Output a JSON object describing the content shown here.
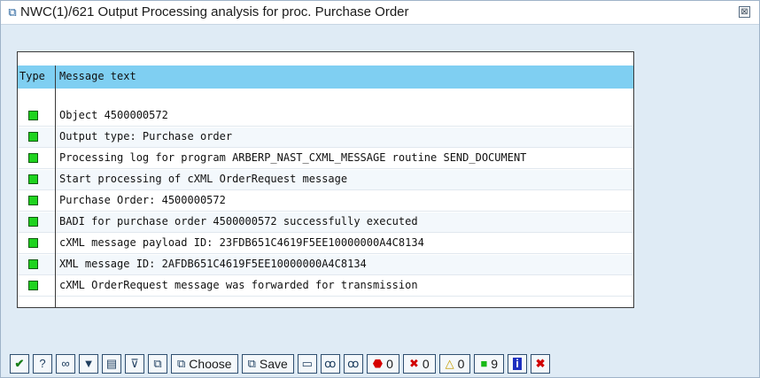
{
  "window": {
    "title": "NWC(1)/621 Output Processing analysis for proc. Purchase Order",
    "close_label": "⊠"
  },
  "table": {
    "columns": [
      "Type",
      "Message text"
    ],
    "rows": [
      {
        "type": "success",
        "text": "Object 4500000572"
      },
      {
        "type": "success",
        "text": "Output type: Purchase order"
      },
      {
        "type": "success",
        "text": "Processing log for program ARBERP_NAST_CXML_MESSAGE routine SEND_DOCUMENT"
      },
      {
        "type": "success",
        "text": "Start processing of cXML OrderRequest message"
      },
      {
        "type": "success",
        "text": "Purchase Order: 4500000572"
      },
      {
        "type": "success",
        "text": "BADI for purchase order 4500000572 successfully executed"
      },
      {
        "type": "success",
        "text": "cXML message payload ID: 23FDB651C4619F5EE10000000A4C8134"
      },
      {
        "type": "success",
        "text": "XML message ID: 2AFDB651C4619F5EE10000000A4C8134"
      },
      {
        "type": "success",
        "text": "cXML OrderRequest message was forwarded for transmission"
      }
    ]
  },
  "toolbar": {
    "choose_label": "Choose",
    "save_label": "Save",
    "stop_count": "0",
    "error_count": "0",
    "warning_count": "0",
    "success_count": "9"
  },
  "icons": {
    "title": "popup-window-icon",
    "check": "checkmark-icon",
    "help": "help-icon",
    "glasses": "glasses-icon",
    "filter": "filter-icon",
    "print": "print-icon",
    "stop": "stop-icon",
    "error": "error-icon",
    "warning": "warning-icon",
    "success": "success-icon",
    "info": "info-icon",
    "cancel": "cancel-icon"
  },
  "colors": {
    "header": "#7fcff2",
    "success_led": "#1fd31f",
    "window_bg": "#dfebf5"
  }
}
